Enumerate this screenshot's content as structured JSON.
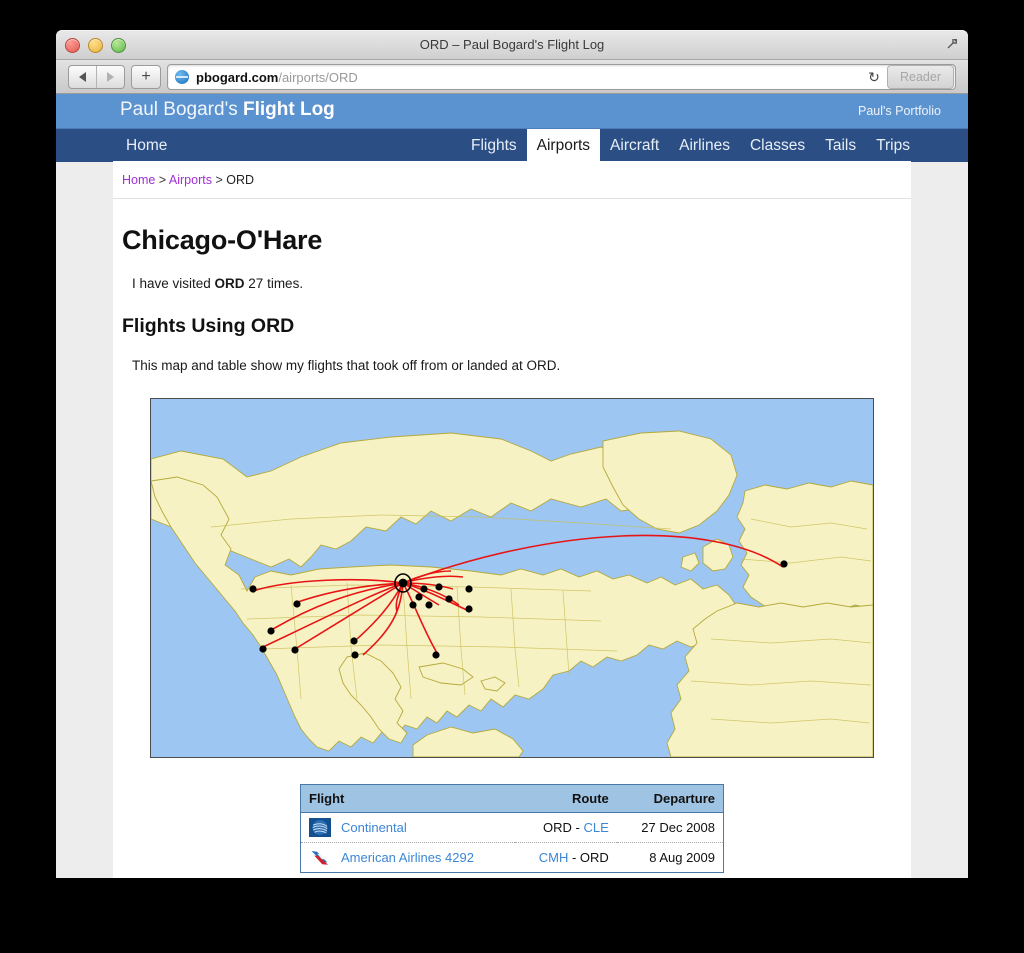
{
  "browser": {
    "window_title": "ORD – Paul Bogard's Flight Log",
    "traffic_lights": [
      "close",
      "minimize",
      "zoom"
    ],
    "back_label": "Back",
    "forward_label": "Forward",
    "add_tab_label": "+",
    "url_host": "pbogard.com",
    "url_path": "/airports/ORD",
    "reload_glyph": "↻",
    "reader_label": "Reader",
    "fullscreen_icon": "fullscreen-icon"
  },
  "site": {
    "brand_prefix": "Paul Bogard's ",
    "brand_strong": "Flight Log",
    "portfolio_link": "Paul's Portfolio"
  },
  "nav": {
    "home": "Home",
    "tabs": [
      {
        "label": "Flights",
        "active": false
      },
      {
        "label": "Airports",
        "active": true
      },
      {
        "label": "Aircraft",
        "active": false
      },
      {
        "label": "Airlines",
        "active": false
      },
      {
        "label": "Classes",
        "active": false
      },
      {
        "label": "Tails",
        "active": false
      },
      {
        "label": "Trips",
        "active": false
      }
    ]
  },
  "breadcrumb": {
    "home": "Home",
    "sep1": " > ",
    "airports": "Airports",
    "sep2": " > ",
    "current": "ORD"
  },
  "page": {
    "title": "Chicago-O'Hare",
    "visits_prefix": "I have visited ",
    "visits_code": "ORD",
    "visits_suffix": " 27 times.",
    "visit_count": 27,
    "section_title": "Flights Using ORD",
    "section_desc": "This map and table show my flights that took off from or landed at ORD."
  },
  "map": {
    "ocean_color": "#9dc6f2",
    "land_color": "#f7f2c4",
    "border_color": "#b5a93a",
    "route_color": "#e81414",
    "marker_color": "#000000",
    "hub": "ORD"
  },
  "table": {
    "columns": [
      "Flight",
      "Route",
      "Departure"
    ],
    "rows": [
      {
        "logo": "continental-logo",
        "airline": "Continental",
        "route_from": "ORD",
        "route_sep": " - ",
        "route_to": "CLE",
        "from_is_link": false,
        "to_is_link": true,
        "departure": "27 Dec 2008"
      },
      {
        "logo": "american-airlines-logo",
        "airline": "American Airlines 4292",
        "route_from": "CMH",
        "route_sep": " - ",
        "route_to": "ORD",
        "from_is_link": true,
        "to_is_link": false,
        "departure": "8 Aug 2009"
      }
    ]
  },
  "colors": {
    "header_blue": "#5b92d0",
    "nav_navy": "#2b4f84",
    "link_blue": "#3b86d6",
    "visited_purple": "#a12fd4",
    "table_header_blue": "#9ec3e3"
  }
}
